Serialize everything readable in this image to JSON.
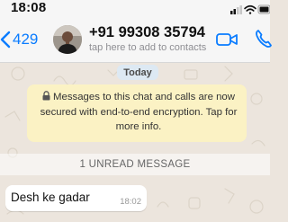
{
  "status_bar": {
    "time": "18:08",
    "icons": [
      "signal-bars-icon",
      "wifi-icon",
      "battery-icon"
    ]
  },
  "header": {
    "back_count": "429",
    "contact_name": "+91 99308 35794",
    "subtitle": "tap here to add to contacts",
    "icons": [
      "chevron-left-icon",
      "video-call-icon",
      "phone-icon"
    ],
    "accent_color": "#0a7cff"
  },
  "chat": {
    "date_label": "Today",
    "encryption_notice": "Messages to this chat and calls are now secured with end-to-end encryption. Tap for more info.",
    "unread_label": "1 UNREAD MESSAGE",
    "messages": [
      {
        "text": "Desh ke gadar",
        "time": "18:02",
        "direction": "incoming"
      }
    ]
  }
}
